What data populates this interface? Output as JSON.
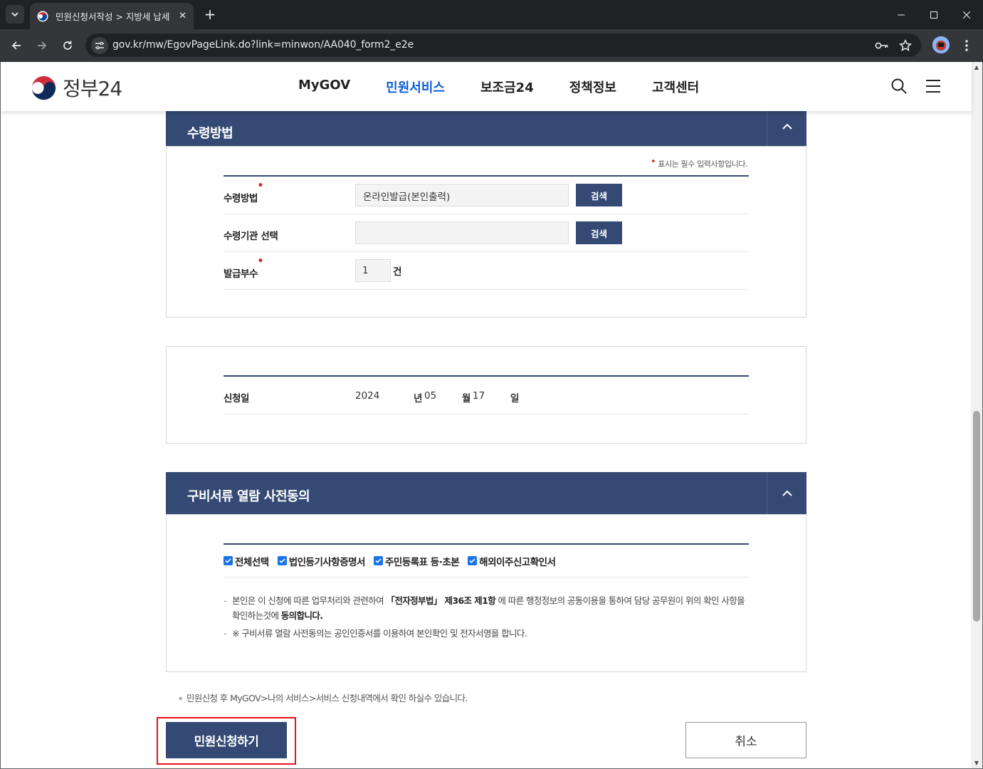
{
  "browser": {
    "tab_title": "민원신청서작성 > 지방세 납세",
    "url": "gov.kr/mw/EgovPageLink.do?link=minwon/AA040_form2_e2e"
  },
  "site": {
    "logo_text": "정부24",
    "nav": [
      "MyGOV",
      "민원서비스",
      "보조금24",
      "정책정보",
      "고객센터"
    ],
    "active_nav": "민원서비스"
  },
  "receipt_section": {
    "title": "수령방법",
    "required_note": "표시는 필수 입력사항입니다.",
    "rows": {
      "method_label": "수령방법",
      "method_value": "온라인발급(본인출력)",
      "agency_label": "수령기관 선택",
      "agency_value": "",
      "copies_label": "발급부수",
      "copies_value": "1",
      "copies_unit": "건"
    },
    "search_label": "검색"
  },
  "date_section": {
    "label": "신청일",
    "year": "2024",
    "year_unit": "년",
    "month": "05",
    "month_unit": "월",
    "day": "17",
    "day_unit": "일"
  },
  "consent_section": {
    "title": "구비서류 열람 사전동의",
    "checkboxes": [
      {
        "label": "전체선택",
        "checked": true
      },
      {
        "label": "법인등기사항증명서",
        "checked": true
      },
      {
        "label": "주민등록표 등·초본",
        "checked": true
      },
      {
        "label": "해외이주신고확인서",
        "checked": true
      }
    ],
    "text1_a": "본인은 이 신청에 따른 업무처리와 관련하여 ",
    "text1_b": "「전자정부법」 제36조 제1항",
    "text1_c": " 에 따른 행정정보의 공동이용을 통하여 담당 공무원이 위의 확인 사항을 확인하는것에 ",
    "text1_d": "동의합니다.",
    "text2": "※ 구비서류 열람 사전동의는 공인인증서를 이용하여 본인확인 및 전자서명을 합니다."
  },
  "info_note": "민원신청 후 MyGOV>나의 서비스>서비스 신청내역에서 확인 하실수 있습니다.",
  "actions": {
    "submit": "민원신청하기",
    "cancel": "취소"
  },
  "colors": {
    "primary": "#344a74",
    "required": "#d8262f",
    "highlight": "#e8101a",
    "active_nav": "#0b5ed7"
  }
}
